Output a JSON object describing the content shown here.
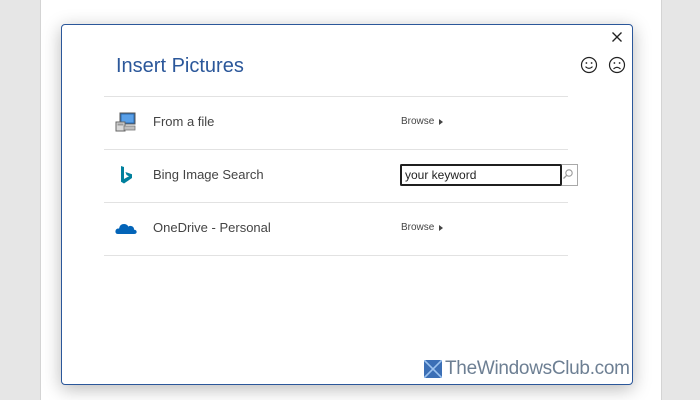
{
  "dialog": {
    "title": "Insert Pictures",
    "close_icon": "close-icon",
    "smile_icon": "smile-icon",
    "frown_icon": "frown-icon"
  },
  "rows": [
    {
      "label": "From a file",
      "icon": "computer-icon",
      "action_label": "Browse"
    },
    {
      "label": "Bing Image Search",
      "icon": "bing-icon",
      "search_value": "your keyword"
    },
    {
      "label": "OneDrive - Personal",
      "icon": "onedrive-icon",
      "action_label": "Browse"
    }
  ],
  "watermark": {
    "text": "TheWindowsClub.com"
  },
  "colors": {
    "accent": "#2b579a",
    "bing": "#00809d",
    "onedrive": "#0364b8",
    "text": "#444444"
  }
}
